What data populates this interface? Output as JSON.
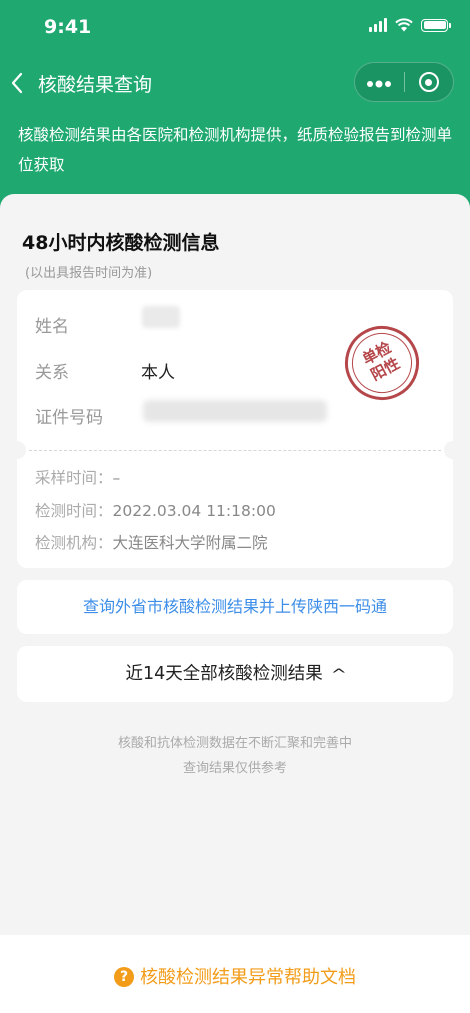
{
  "status_bar": {
    "time": "9:41"
  },
  "nav": {
    "back_icon": "chevron-left-icon",
    "title": "核酸结果查询",
    "more_icon": "more-dots-icon",
    "close_icon": "target-circle-icon"
  },
  "colors": {
    "header": "#1fa971",
    "link": "#3d8ee8",
    "help": "#f39c1a",
    "stamp": "#b5474a"
  },
  "description": "核酸检测结果由各医院和检测机构提供，纸质检验报告到检测单位获取",
  "section": {
    "title": "48小时内核酸检测信息",
    "subtitle": "(以出具报告时间为准)"
  },
  "record": {
    "name_label": "姓名",
    "name_value": "",
    "relation_label": "关系",
    "relation_value": "本人",
    "id_label": "证件号码",
    "id_value": "",
    "stamp_line1": "单检",
    "stamp_line2": "阳性",
    "sample_time_label": "采样时间：",
    "sample_time_value": "–",
    "test_time_label": "检测时间：",
    "test_time_value": "2022.03.04 11:18:00",
    "institution_label": "检测机构：",
    "institution_value": "大连医科大学附属二院"
  },
  "actions": {
    "upload_link": "查询外省市核酸检测结果并上传陕西一码通",
    "all_results": "近14天全部核酸检测结果",
    "all_results_icon": "chevron-up-icon"
  },
  "note": {
    "line1": "核酸和抗体检测数据在不断汇聚和完善中",
    "line2": "查询结果仅供参考"
  },
  "help": {
    "icon": "question-circle-icon",
    "label": "核酸检测结果异常帮助文档"
  }
}
